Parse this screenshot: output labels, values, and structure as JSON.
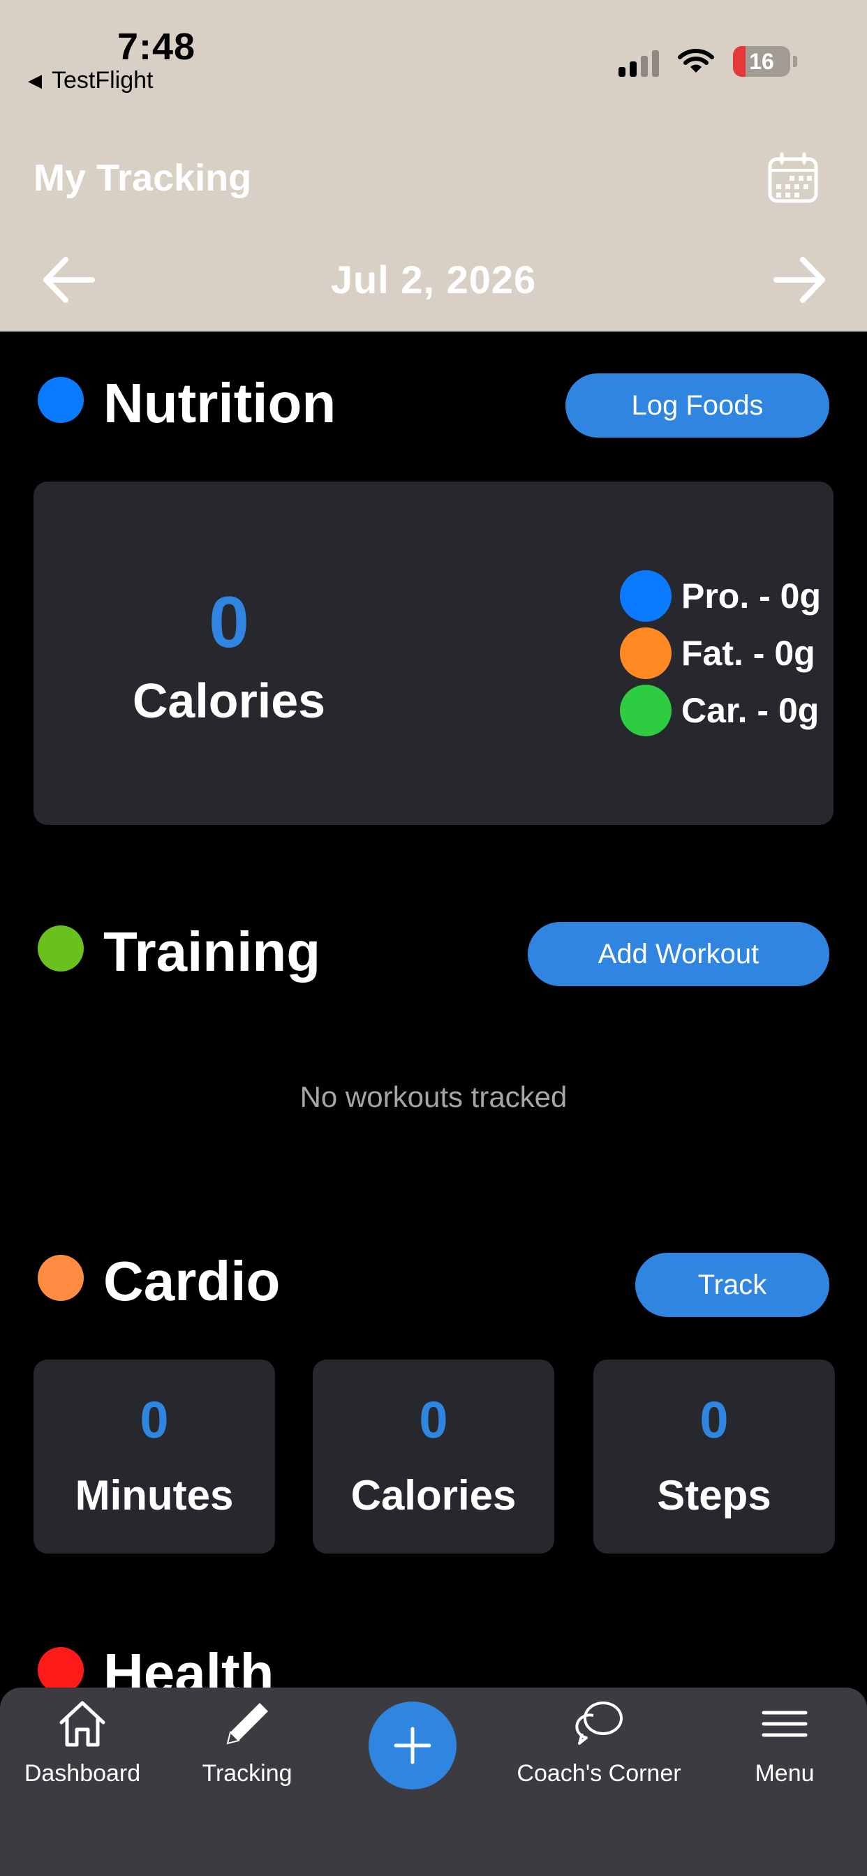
{
  "status_bar": {
    "time": "7:48",
    "back_app": "TestFlight",
    "battery": "16"
  },
  "header": {
    "title": "My Tracking",
    "date": "Jul 2, 2026"
  },
  "nutrition": {
    "title": "Nutrition",
    "button": "Log Foods",
    "calories_value": "0",
    "calories_label": "Calories",
    "macros": [
      {
        "label": "Pro. - 0g",
        "color": "#0a7aff"
      },
      {
        "label": "Fat. - 0g",
        "color": "#ff8a24"
      },
      {
        "label": "Car. - 0g",
        "color": "#2ecc40"
      }
    ],
    "dot_color": "#0a7aff"
  },
  "training": {
    "title": "Training",
    "button": "Add Workout",
    "empty_text": "No workouts tracked",
    "dot_color": "#6ac11e"
  },
  "cardio": {
    "title": "Cardio",
    "button": "Track",
    "dot_color": "#ff8c42",
    "stats": [
      {
        "value": "0",
        "label": "Minutes"
      },
      {
        "value": "0",
        "label": "Calories"
      },
      {
        "value": "0",
        "label": "Steps"
      }
    ]
  },
  "health": {
    "title": "Health",
    "dot_color": "#ff1a1a"
  },
  "tab_bar": {
    "items": [
      {
        "label": "Dashboard",
        "icon": "home-icon"
      },
      {
        "label": "Tracking",
        "icon": "pencil-icon"
      },
      {
        "label": "",
        "icon": "plus-icon"
      },
      {
        "label": "Coach's Corner",
        "icon": "chat-bubbles-icon"
      },
      {
        "label": "Menu",
        "icon": "hamburger-icon"
      }
    ]
  },
  "colors": {
    "accent": "#2f85e0",
    "header_bg": "#d8d0c4",
    "card_bg": "#26282d",
    "tab_bar_bg": "#3b3b40"
  }
}
